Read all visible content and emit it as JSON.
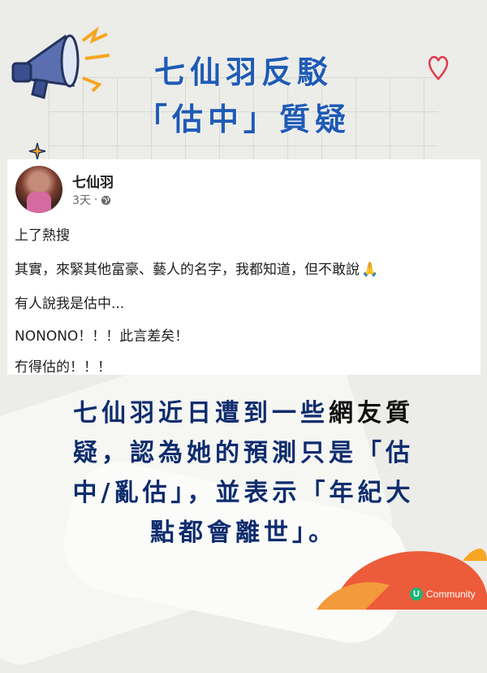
{
  "header": {
    "title_line1": "七仙羽反駁",
    "title_line2": "「估中」質疑"
  },
  "post": {
    "author": "七仙羽",
    "time": "3天",
    "dot": "·",
    "lines": [
      "上了熱搜",
      "其實，來緊其他富豪、藝人的名字，我都知道，但不敢說",
      "有人說我是估中...",
      "NONONO！！！此言差矣！",
      "冇得估的！！！"
    ],
    "emoji": "🙏"
  },
  "article": {
    "line1_part1": "七仙羽近日遭到一些",
    "line1_part2": "網友質",
    "line2": "疑，認為她的預測只是「估",
    "line3": "中/亂估」，並表示「年紀大",
    "line4": "點都會離世」。"
  },
  "brand": {
    "logo_letter": "U",
    "name": "Community"
  },
  "colors": {
    "title": "#1f5bb5",
    "body": "#0f2d6e",
    "megaphone_flash": "#f6a623",
    "heart": "#e23a4a",
    "blob": "#ec5b3a"
  }
}
